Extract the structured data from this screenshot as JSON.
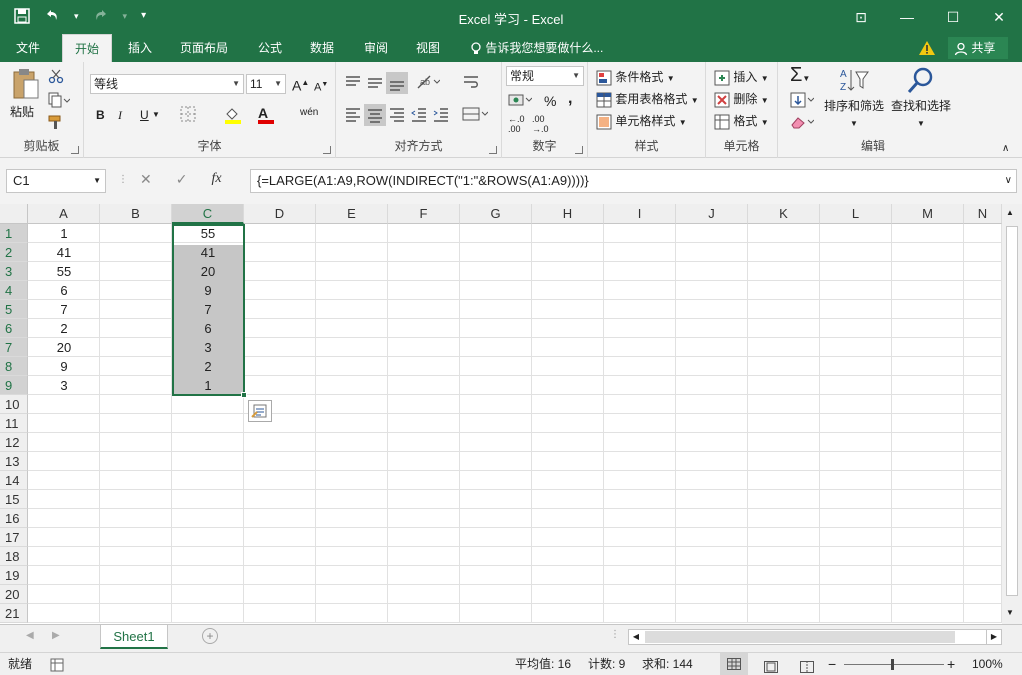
{
  "window": {
    "title": "Excel 学习 - Excel",
    "controls": [
      "⊡",
      "—",
      "☐",
      "✕"
    ]
  },
  "qat": {
    "save": "💾",
    "undo": "↶",
    "redo": "↷",
    "customize": "▾"
  },
  "tabs": [
    {
      "label": "文件"
    },
    {
      "label": "开始"
    },
    {
      "label": "插入"
    },
    {
      "label": "页面布局"
    },
    {
      "label": "公式"
    },
    {
      "label": "数据"
    },
    {
      "label": "审阅"
    },
    {
      "label": "视图"
    }
  ],
  "tellme": "告诉我您想要做什么...",
  "share": "共享",
  "ribbon": {
    "clipboard": {
      "label": "剪贴板",
      "paste": "粘贴"
    },
    "font": {
      "label": "字体",
      "name": "等线",
      "size": "11",
      "bold": "B",
      "italic": "I",
      "underline": "U",
      "grow": "A",
      "shrink": "A",
      "fontcolor": "A",
      "phonetic": "wén"
    },
    "align": {
      "label": "对齐方式"
    },
    "number": {
      "label": "数字",
      "format": "常规",
      "percent": "%",
      "comma": ","
    },
    "styles": {
      "label": "样式",
      "conditional": "条件格式",
      "table": "套用表格格式",
      "cell": "单元格样式"
    },
    "cells": {
      "label": "单元格",
      "insert": "插入",
      "delete": "删除",
      "format": "格式"
    },
    "editing": {
      "label": "编辑",
      "sort": "排序和筛选",
      "find": "查找和选择"
    }
  },
  "formula_bar": {
    "namebox": "C1",
    "cancel": "✕",
    "enter": "✓",
    "fx": "fx",
    "formula": "{=LARGE(A1:A9,ROW(INDIRECT(\"1:\"&ROWS(A1:A9))))}"
  },
  "grid": {
    "columns": [
      "A",
      "B",
      "C",
      "D",
      "E",
      "F",
      "G",
      "H",
      "I",
      "J",
      "K",
      "L",
      "M",
      "N"
    ],
    "rows": [
      "1",
      "2",
      "3",
      "4",
      "5",
      "6",
      "7",
      "8",
      "9",
      "10",
      "11",
      "12",
      "13",
      "14",
      "15",
      "16",
      "17",
      "18",
      "19",
      "20",
      "21"
    ],
    "colA": [
      "1",
      "41",
      "55",
      "6",
      "7",
      "2",
      "20",
      "9",
      "3"
    ],
    "colC": [
      "55",
      "41",
      "20",
      "9",
      "7",
      "6",
      "3",
      "2",
      "1"
    ]
  },
  "sheet_tab": "Sheet1",
  "status": {
    "ready": "就绪",
    "average": "平均值: 16",
    "count": "计数: 9",
    "sum": "求和: 144",
    "zoom": "100%"
  }
}
